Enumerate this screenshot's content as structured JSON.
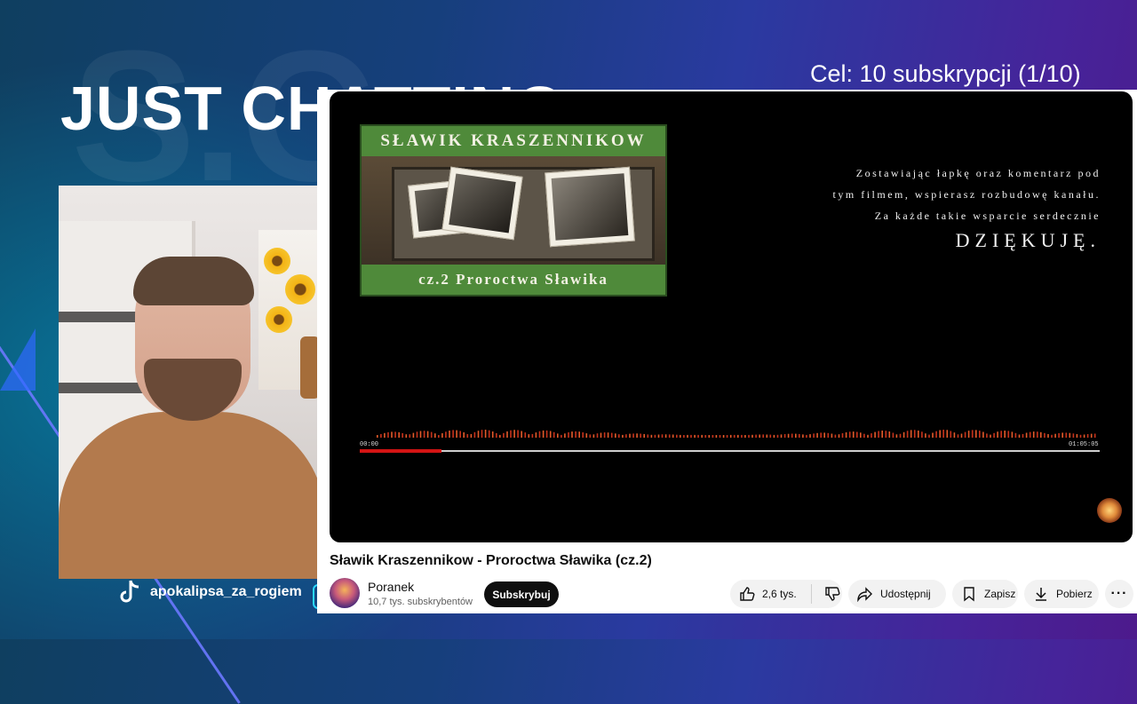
{
  "stream": {
    "title": "JUST CHATTING",
    "goal": "Cel: 10 subskrypcji (1/10)",
    "tiktok_handle": "apokalipsa_za_rogiem"
  },
  "video": {
    "thumbnail_top": "SŁAWIK KRASZENNIKOW",
    "thumbnail_bottom": "cz.2  Proroctwa Sławika",
    "overlay_lines": [
      "Zostawiając łapkę oraz komentarz pod",
      "tym filmem, wspierasz rozbudowę kanału.",
      "Za każde takie wsparcie serdecznie"
    ],
    "overlay_thanks": "DZIĘKUJĘ.",
    "time_current": "00:00",
    "time_total": "01:05:05",
    "progress": 0.11,
    "title": "Sławik Kraszennikow - Proroctwa Sławika (cz.2)"
  },
  "channel": {
    "name": "Poranek",
    "subscribers": "10,7 tys. subskrybentów",
    "subscribe_label": "Subskrybuj"
  },
  "actions": {
    "likes": "2,6 tys.",
    "share": "Udostępnij",
    "save": "Zapisz",
    "download": "Pobierz",
    "more": "···"
  },
  "colors": {
    "progress": "#d41414",
    "thumbnail_green": "#4f8a3a"
  }
}
